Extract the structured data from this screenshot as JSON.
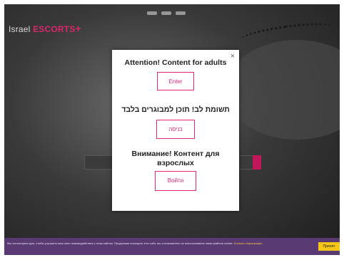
{
  "header": {
    "logo_prefix": "Israel",
    "logo_brand": "ESCORTS",
    "logo_mark": "+"
  },
  "modal": {
    "close_label": "×",
    "sections": [
      {
        "heading": "Attention! Content for adults",
        "button": "Enter"
      },
      {
        "heading": "תשומת לב! תוכן למבוגרים בלבד",
        "button": "כניסה"
      },
      {
        "heading": "Внимание! Контент для взрослых",
        "button": "Войти"
      }
    ]
  },
  "cookie_bar": {
    "text": "Мы используем куки, чтобы улучшить ваш опыт взаимодействия с этим сайтом. Продолжая посещать этот сайт, вы соглашаетесь на использование нами файлов cookie.",
    "more_link": "Больше информации",
    "accept_label": "Принят"
  },
  "colors": {
    "accent": "#e2267a",
    "cookie_bg": "#5a3a72",
    "accept_bg": "#f5c518"
  }
}
